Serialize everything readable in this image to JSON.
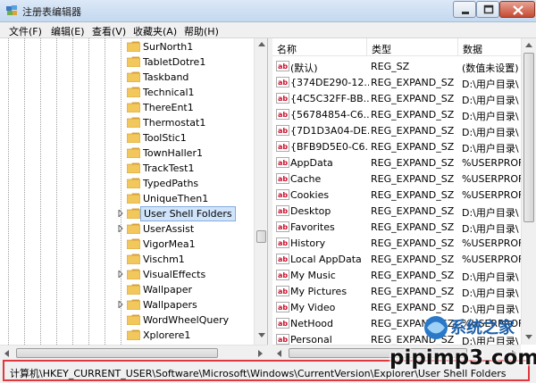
{
  "window": {
    "title": "注册表编辑器"
  },
  "menu": [
    "文件(F)",
    "编辑(E)",
    "查看(V)",
    "收藏夹(A)",
    "帮助(H)"
  ],
  "tree": {
    "items": [
      {
        "label": "SurNorth1"
      },
      {
        "label": "TabletDotre1"
      },
      {
        "label": "Taskband"
      },
      {
        "label": "Technical1"
      },
      {
        "label": "ThereEnt1"
      },
      {
        "label": "Thermostat1"
      },
      {
        "label": "ToolStic1"
      },
      {
        "label": "TownHaller1"
      },
      {
        "label": "TrackTest1"
      },
      {
        "label": "TypedPaths"
      },
      {
        "label": "UniqueThen1"
      },
      {
        "label": "User Shell Folders",
        "selected": true,
        "expandable": true
      },
      {
        "label": "UserAssist",
        "expandable": true
      },
      {
        "label": "VigorMea1"
      },
      {
        "label": "Vischm1"
      },
      {
        "label": "VisualEffects",
        "expandable": true
      },
      {
        "label": "Wallpaper"
      },
      {
        "label": "Wallpapers",
        "expandable": true
      },
      {
        "label": "WordWheelQuery"
      },
      {
        "label": "Xplorere1"
      }
    ]
  },
  "values": {
    "headers": {
      "name": "名称",
      "type": "类型",
      "data": "数据"
    },
    "rows": [
      {
        "name": "(默认)",
        "type": "REG_SZ",
        "data": "(数值未设置)"
      },
      {
        "name": "{374DE290-12...",
        "type": "REG_EXPAND_SZ",
        "data": "D:\\用户目录\\"
      },
      {
        "name": "{4C5C32FF-BB...",
        "type": "REG_EXPAND_SZ",
        "data": "D:\\用户目录\\"
      },
      {
        "name": "{56784854-C6...",
        "type": "REG_EXPAND_SZ",
        "data": "D:\\用户目录\\"
      },
      {
        "name": "{7D1D3A04-DE...",
        "type": "REG_EXPAND_SZ",
        "data": "D:\\用户目录\\"
      },
      {
        "name": "{BFB9D5E0-C6...",
        "type": "REG_EXPAND_SZ",
        "data": "D:\\用户目录\\"
      },
      {
        "name": "AppData",
        "type": "REG_EXPAND_SZ",
        "data": "%USERPROF"
      },
      {
        "name": "Cache",
        "type": "REG_EXPAND_SZ",
        "data": "%USERPROF"
      },
      {
        "name": "Cookies",
        "type": "REG_EXPAND_SZ",
        "data": "%USERPROF"
      },
      {
        "name": "Desktop",
        "type": "REG_EXPAND_SZ",
        "data": "D:\\用户目录\\"
      },
      {
        "name": "Favorites",
        "type": "REG_EXPAND_SZ",
        "data": "D:\\用户目录\\"
      },
      {
        "name": "History",
        "type": "REG_EXPAND_SZ",
        "data": "%USERPROF"
      },
      {
        "name": "Local AppData",
        "type": "REG_EXPAND_SZ",
        "data": "%USERPROF"
      },
      {
        "name": "My Music",
        "type": "REG_EXPAND_SZ",
        "data": "D:\\用户目录\\"
      },
      {
        "name": "My Pictures",
        "type": "REG_EXPAND_SZ",
        "data": "D:\\用户目录\\"
      },
      {
        "name": "My Video",
        "type": "REG_EXPAND_SZ",
        "data": "D:\\用户目录\\"
      },
      {
        "name": "NetHood",
        "type": "REG_EXPAND_SZ",
        "data": "%USERPROF"
      },
      {
        "name": "Personal",
        "type": "REG_EXPAND_SZ",
        "data": "D:\\用户目录\\"
      }
    ]
  },
  "status": {
    "path": "计算机\\HKEY_CURRENT_USER\\Software\\Microsoft\\Windows\\CurrentVersion\\Explorer\\User Shell Folders"
  },
  "watermark": {
    "brand": "系统之家",
    "url": "pipimp3.com"
  },
  "colors": {
    "selection": "#cfe4fa",
    "status_highlight": "#e0383e",
    "value_icon": "#c8102e",
    "folder": "#e8b84a"
  }
}
